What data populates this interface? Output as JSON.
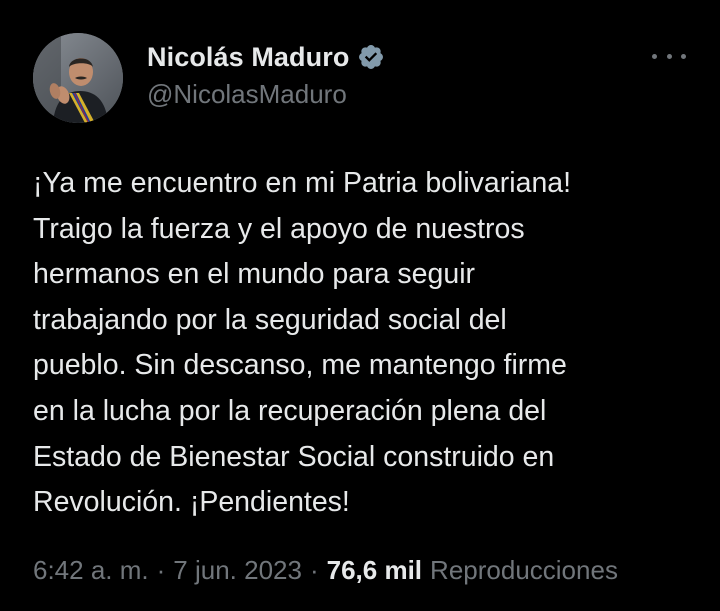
{
  "author": {
    "display_name": "Nicolás Maduro",
    "handle": "@NicolasMaduro",
    "verified_icon": "verified-badge-icon"
  },
  "tweet": {
    "text": "¡Ya me encuentro en mi Patria bolivariana!\nTraigo la fuerza y el apoyo de nuestros\nhermanos en el mundo para seguir\ntrabajando por la seguridad social del\npueblo. Sin descanso, me mantengo firme\nen la lucha por la recuperación plena del\nEstado de Bienestar Social construido en\nRevolución. ¡Pendientes!"
  },
  "meta": {
    "time": "6:42 a. m.",
    "separator": "·",
    "date": "7 jun. 2023",
    "views_count": "76,6 mil",
    "views_label": "Reproducciones"
  },
  "icons": {
    "more": "more-horizontal-icon"
  },
  "colors": {
    "background": "#000000",
    "text_primary": "#e7e9ea",
    "text_secondary": "#71767b",
    "verified_badge": "#829aab"
  }
}
